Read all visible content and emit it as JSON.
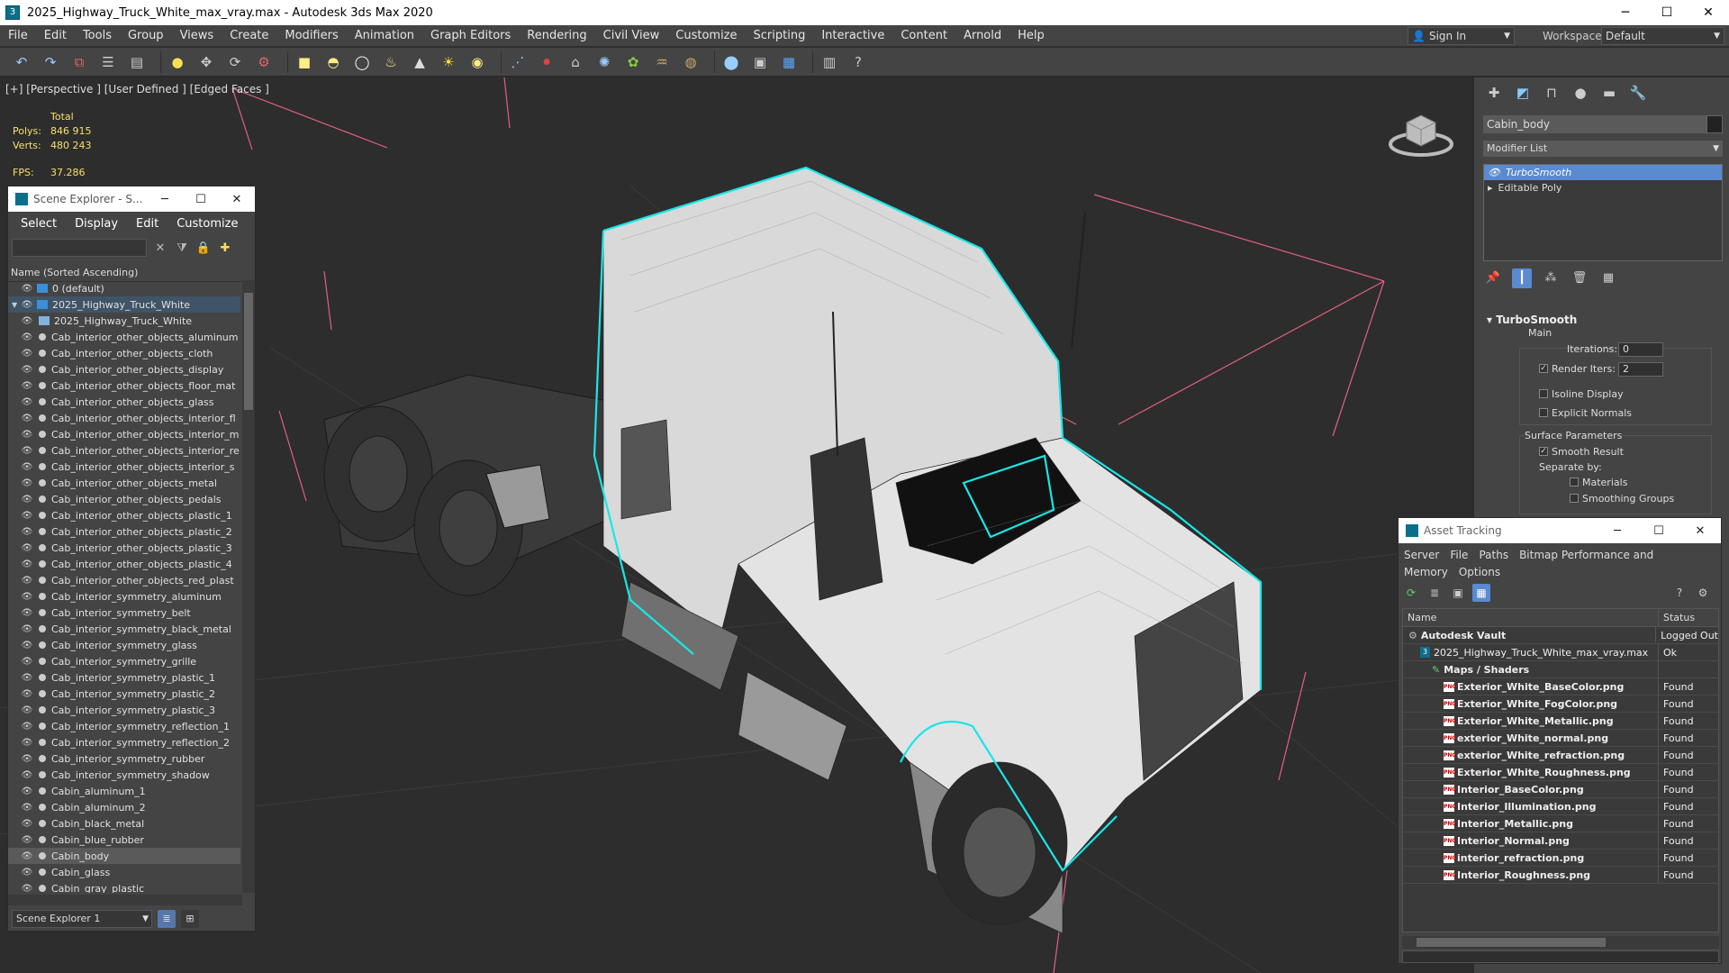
{
  "window": {
    "title": "2025_Highway_Truck_White_max_vray.max - Autodesk 3ds Max 2020",
    "minimize": "─",
    "maximize": "☐",
    "close": "✕"
  },
  "menu": [
    "File",
    "Edit",
    "Tools",
    "Group",
    "Views",
    "Create",
    "Modifiers",
    "Animation",
    "Graph Editors",
    "Rendering",
    "Civil View",
    "Customize",
    "Scripting",
    "Interactive",
    "Content",
    "Arnold",
    "Help"
  ],
  "account": {
    "sign_in": "Sign In",
    "workspaces_label": "Workspaces:",
    "workspace": "Default"
  },
  "viewport": {
    "label": "[+] [Perspective ] [User Defined ] [Edged Faces ]",
    "stats_header": "Total",
    "polys_label": "Polys:",
    "polys": "846 915",
    "verts_label": "Verts:",
    "verts": "480 243",
    "fps_label": "FPS:",
    "fps": "37.286"
  },
  "scene_explorer": {
    "title": "Scene Explorer - S...",
    "menu": [
      "Select",
      "Display",
      "Edit",
      "Customize"
    ],
    "column_header": "Name (Sorted Ascending)",
    "items": [
      {
        "label": "0 (default)",
        "kind": "layer",
        "indent": 0,
        "state": "normal"
      },
      {
        "label": "2025_Highway_Truck_White",
        "kind": "layer",
        "indent": 0,
        "state": "top",
        "expanded": true
      },
      {
        "label": "2025_Highway_Truck_White",
        "kind": "group",
        "indent": 1,
        "state": "normal"
      },
      {
        "label": "Cab_interior_other_objects_aluminum",
        "kind": "obj",
        "indent": 1,
        "state": "normal"
      },
      {
        "label": "Cab_interior_other_objects_cloth",
        "kind": "obj",
        "indent": 1,
        "state": "normal"
      },
      {
        "label": "Cab_interior_other_objects_display",
        "kind": "obj",
        "indent": 1,
        "state": "normal"
      },
      {
        "label": "Cab_interior_other_objects_floor_mat",
        "kind": "obj",
        "indent": 1,
        "state": "normal"
      },
      {
        "label": "Cab_interior_other_objects_glass",
        "kind": "obj",
        "indent": 1,
        "state": "normal"
      },
      {
        "label": "Cab_interior_other_objects_interior_fl",
        "kind": "obj",
        "indent": 1,
        "state": "normal"
      },
      {
        "label": "Cab_interior_other_objects_interior_m",
        "kind": "obj",
        "indent": 1,
        "state": "normal"
      },
      {
        "label": "Cab_interior_other_objects_interior_re",
        "kind": "obj",
        "indent": 1,
        "state": "normal"
      },
      {
        "label": "Cab_interior_other_objects_interior_s",
        "kind": "obj",
        "indent": 1,
        "state": "normal"
      },
      {
        "label": "Cab_interior_other_objects_metal",
        "kind": "obj",
        "indent": 1,
        "state": "normal"
      },
      {
        "label": "Cab_interior_other_objects_pedals",
        "kind": "obj",
        "indent": 1,
        "state": "normal"
      },
      {
        "label": "Cab_interior_other_objects_plastic_1",
        "kind": "obj",
        "indent": 1,
        "state": "normal"
      },
      {
        "label": "Cab_interior_other_objects_plastic_2",
        "kind": "obj",
        "indent": 1,
        "state": "normal"
      },
      {
        "label": "Cab_interior_other_objects_plastic_3",
        "kind": "obj",
        "indent": 1,
        "state": "normal"
      },
      {
        "label": "Cab_interior_other_objects_plastic_4",
        "kind": "obj",
        "indent": 1,
        "state": "normal"
      },
      {
        "label": "Cab_interior_other_objects_red_plast",
        "kind": "obj",
        "indent": 1,
        "state": "normal"
      },
      {
        "label": "Cab_interior_symmetry_aluminum",
        "kind": "obj",
        "indent": 1,
        "state": "normal"
      },
      {
        "label": "Cab_interior_symmetry_belt",
        "kind": "obj",
        "indent": 1,
        "state": "normal"
      },
      {
        "label": "Cab_interior_symmetry_black_metal",
        "kind": "obj",
        "indent": 1,
        "state": "normal"
      },
      {
        "label": "Cab_interior_symmetry_glass",
        "kind": "obj",
        "indent": 1,
        "state": "normal"
      },
      {
        "label": "Cab_interior_symmetry_grille",
        "kind": "obj",
        "indent": 1,
        "state": "normal"
      },
      {
        "label": "Cab_interior_symmetry_plastic_1",
        "kind": "obj",
        "indent": 1,
        "state": "normal"
      },
      {
        "label": "Cab_interior_symmetry_plastic_2",
        "kind": "obj",
        "indent": 1,
        "state": "normal"
      },
      {
        "label": "Cab_interior_symmetry_plastic_3",
        "kind": "obj",
        "indent": 1,
        "state": "normal"
      },
      {
        "label": "Cab_interior_symmetry_reflection_1",
        "kind": "obj",
        "indent": 1,
        "state": "normal"
      },
      {
        "label": "Cab_interior_symmetry_reflection_2",
        "kind": "obj",
        "indent": 1,
        "state": "normal"
      },
      {
        "label": "Cab_interior_symmetry_rubber",
        "kind": "obj",
        "indent": 1,
        "state": "normal"
      },
      {
        "label": "Cab_interior_symmetry_shadow",
        "kind": "obj",
        "indent": 1,
        "state": "normal"
      },
      {
        "label": "Cabin_aluminum_1",
        "kind": "obj",
        "indent": 1,
        "state": "normal"
      },
      {
        "label": "Cabin_aluminum_2",
        "kind": "obj",
        "indent": 1,
        "state": "normal"
      },
      {
        "label": "Cabin_black_metal",
        "kind": "obj",
        "indent": 1,
        "state": "normal"
      },
      {
        "label": "Cabin_blue_rubber",
        "kind": "obj",
        "indent": 1,
        "state": "normal"
      },
      {
        "label": "Cabin_body",
        "kind": "obj",
        "indent": 1,
        "state": "sel"
      },
      {
        "label": "Cabin_glass",
        "kind": "obj",
        "indent": 1,
        "state": "normal"
      },
      {
        "label": "Cabin_gray_plastic",
        "kind": "obj",
        "indent": 1,
        "state": "normal"
      }
    ],
    "footer_combo": "Scene Explorer 1"
  },
  "command_panel": {
    "object_name": "Cabin_body",
    "modifier_list": "Modifier List",
    "stack": [
      {
        "label": "TurboSmooth",
        "active": true
      },
      {
        "label": "Editable Poly",
        "active": false
      }
    ],
    "rollout_title": "TurboSmooth",
    "main_label": "Main",
    "iterations_label": "Iterations:",
    "iterations": "0",
    "render_iters_label": "Render Iters:",
    "render_iters": "2",
    "isoline": "Isoline Display",
    "explicit_normals": "Explicit Normals",
    "surface_params": "Surface Parameters",
    "smooth_result": "Smooth Result",
    "separate_by": "Separate by:",
    "materials": "Materials",
    "smoothing_groups": "Smoothing Groups"
  },
  "asset_tracking": {
    "title": "Asset Tracking",
    "menu": [
      "Server",
      "File",
      "Paths",
      "Bitmap Performance and Memory",
      "Options"
    ],
    "col_name": "Name",
    "col_status": "Status",
    "rows": [
      {
        "name": "Autodesk Vault",
        "status": "Logged Out",
        "indent": 0,
        "kind": "vault",
        "bold": true
      },
      {
        "name": "2025_Highway_Truck_White_max_vray.max",
        "status": "Ok",
        "indent": 1,
        "kind": "max",
        "bold": false
      },
      {
        "name": "Maps / Shaders",
        "status": "",
        "indent": 2,
        "kind": "maps",
        "bold": true
      },
      {
        "name": "Exterior_White_BaseColor.png",
        "status": "Found",
        "indent": 3,
        "kind": "png",
        "bold": true
      },
      {
        "name": "Exterior_White_FogColor.png",
        "status": "Found",
        "indent": 3,
        "kind": "png",
        "bold": true
      },
      {
        "name": "Exterior_White_Metallic.png",
        "status": "Found",
        "indent": 3,
        "kind": "png",
        "bold": true
      },
      {
        "name": "exterior_White_normal.png",
        "status": "Found",
        "indent": 3,
        "kind": "png",
        "bold": true
      },
      {
        "name": "exterior_White_refraction.png",
        "status": "Found",
        "indent": 3,
        "kind": "png",
        "bold": true
      },
      {
        "name": "Exterior_White_Roughness.png",
        "status": "Found",
        "indent": 3,
        "kind": "png",
        "bold": true
      },
      {
        "name": "Interior_BaseColor.png",
        "status": "Found",
        "indent": 3,
        "kind": "png",
        "bold": true
      },
      {
        "name": "Interior_Illumination.png",
        "status": "Found",
        "indent": 3,
        "kind": "png",
        "bold": true
      },
      {
        "name": "Interior_Metallic.png",
        "status": "Found",
        "indent": 3,
        "kind": "png",
        "bold": true
      },
      {
        "name": "Interior_Normal.png",
        "status": "Found",
        "indent": 3,
        "kind": "png",
        "bold": true
      },
      {
        "name": "interior_refraction.png",
        "status": "Found",
        "indent": 3,
        "kind": "png",
        "bold": true
      },
      {
        "name": "Interior_Roughness.png",
        "status": "Found",
        "indent": 3,
        "kind": "png",
        "bold": true
      }
    ]
  },
  "colors": {
    "selection_cyan": "#19e6e6",
    "bbox_pink": "#e06080",
    "active_blue": "#5a8ad0",
    "stats_yellow": "#f5e06a"
  }
}
